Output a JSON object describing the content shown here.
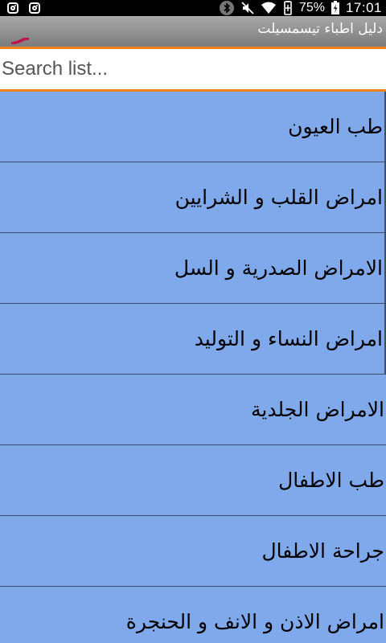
{
  "status_bar": {
    "battery": "75%",
    "time": "17:01",
    "icons": [
      "instagram-icon",
      "instagram-icon",
      "bluetooth-icon",
      "mute-icon",
      "wifi-icon",
      "battery-saver-icon",
      "battery-icon"
    ]
  },
  "app": {
    "title": "دليل اطباء تيسمسيلت"
  },
  "search": {
    "placeholder": "Search list..."
  },
  "list": {
    "items": [
      {
        "label": "طب العيون"
      },
      {
        "label": "امراض القلب و الشرايين"
      },
      {
        "label": "الامراض الصدرية و السل"
      },
      {
        "label": "امراض النساء و التوليد"
      },
      {
        "label": "الامراض الجلدية"
      },
      {
        "label": "طب الاطفال"
      },
      {
        "label": "جراحة الاطفال"
      },
      {
        "label": "امراض الاذن و الانف و الحنجرة"
      }
    ]
  },
  "colors": {
    "list_background": "#7fa9ea",
    "accent": "#f0821c",
    "divider": "#3d4d66"
  }
}
